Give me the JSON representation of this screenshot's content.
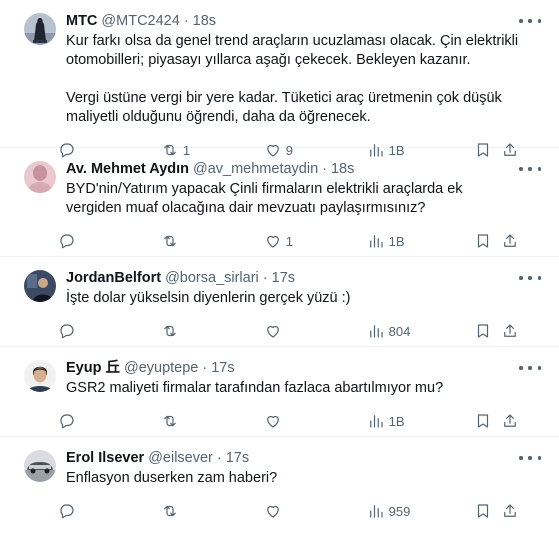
{
  "tweets": [
    {
      "name": "MTC",
      "handle": "@MTC2424",
      "sep": "·",
      "time": "18s",
      "avatar": "statue-avatar",
      "text": [
        "Kur farkı olsa da genel trend araçların ucuzlaması olacak. Çin elektrikli otomobilleri; piyasayı yıllarca aşağı çekecek. Bekleyen kazanır.",
        "Vergi üstüne vergi bir yere kadar. Tüketici araç üretmenin çok düşük maliyetli olduğunu öğrendi, daha da öğrenecek."
      ],
      "replies": "",
      "retweets": "1",
      "likes": "9",
      "views": "1B"
    },
    {
      "name": "Av. Mehmet Aydın",
      "handle": "@av_mehmetaydin",
      "sep": "·",
      "time": "18s",
      "avatar": "person-avatar",
      "text": [
        "BYD'nin/Yatırım yapacak Çinli firmaların elektrikli araçlarda ek vergiden muaf olacağına dair mevzuatı paylaşırmısınız?"
      ],
      "replies": "",
      "retweets": "",
      "likes": "1",
      "views": "1B"
    },
    {
      "name": "JordanBelfort",
      "handle": "@borsa_sirlari",
      "sep": "·",
      "time": "17s",
      "avatar": "person-avatar",
      "text": [
        "İşte dolar yükselsin diyenlerin gerçek yüzü :)"
      ],
      "replies": "",
      "retweets": "",
      "likes": "",
      "views": "804"
    },
    {
      "name": "Eyup 丘",
      "handle": "@eyuptepe",
      "sep": "·",
      "time": "17s",
      "avatar": "person-avatar",
      "text": [
        "GSR2 maliyeti firmalar tarafından fazlaca abartılmıyor mu?"
      ],
      "replies": "",
      "retweets": "",
      "likes": "",
      "views": "1B"
    },
    {
      "name": "Erol Ilsever",
      "handle": "@eilsever",
      "sep": "·",
      "time": "17s",
      "avatar": "car-avatar",
      "text": [
        "Enflasyon duserken zam haberi?"
      ],
      "replies": "",
      "retweets": "",
      "likes": "",
      "views": "959"
    }
  ],
  "colors": {
    "text": "#0f1419",
    "muted": "#536471",
    "divider": "#eff3f4"
  },
  "icons": {
    "reply": "speech-bubble-icon",
    "retweet": "retweet-icon",
    "like": "heart-icon",
    "views": "bar-chart-icon",
    "bookmark": "bookmark-icon",
    "share": "share-icon",
    "more": "more-dots-icon"
  }
}
